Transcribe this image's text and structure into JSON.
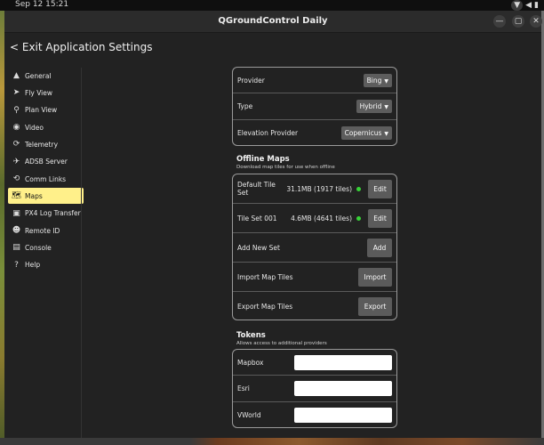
{
  "os": {
    "clock": "Sep 12  15:21",
    "tray": [
      "wifi-icon",
      "volume-icon",
      "battery-icon"
    ]
  },
  "window": {
    "title": "QGroundControl Daily",
    "controls": [
      "—",
      "▢",
      "✕"
    ]
  },
  "header": {
    "exit_label": "< Exit Application Settings"
  },
  "sidebar": {
    "items": [
      {
        "label": "General",
        "icon": "qgc-logo-icon",
        "glyph": "▲"
      },
      {
        "label": "Fly View",
        "icon": "paper-plane-icon",
        "glyph": "➤"
      },
      {
        "label": "Plan View",
        "icon": "map-pin-icon",
        "glyph": "⚲"
      },
      {
        "label": "Video",
        "icon": "camera-icon",
        "glyph": "◉"
      },
      {
        "label": "Telemetry",
        "icon": "telemetry-icon",
        "glyph": "⟳"
      },
      {
        "label": "ADSB Server",
        "icon": "airplane-icon",
        "glyph": "✈"
      },
      {
        "label": "Comm Links",
        "icon": "link-icon",
        "glyph": "⟲"
      },
      {
        "label": "Maps",
        "icon": "map-icon",
        "glyph": "🗺"
      },
      {
        "label": "PX4 Log Transfer",
        "icon": "log-transfer-icon",
        "glyph": "▣"
      },
      {
        "label": "Remote ID",
        "icon": "person-icon",
        "glyph": "☻"
      },
      {
        "label": "Console",
        "icon": "console-icon",
        "glyph": "▤"
      },
      {
        "label": "Help",
        "icon": "help-icon",
        "glyph": "?"
      }
    ],
    "active_index": 7
  },
  "map_settings": {
    "provider_label": "Provider",
    "provider_value": "Bing",
    "type_label": "Type",
    "type_value": "Hybrid",
    "elevation_label": "Elevation Provider",
    "elevation_value": "Copernicus"
  },
  "offline_maps": {
    "title": "Offline Maps",
    "subtitle": "Download map tiles for use when offline",
    "sets": [
      {
        "name": "Default Tile Set",
        "size": "31.1MB (1917 tiles)",
        "button": "Edit",
        "status_color": "#37d437"
      },
      {
        "name": "Tile Set 001",
        "size": "4.6MB (4641 tiles)",
        "button": "Edit",
        "status_color": "#37d437"
      }
    ],
    "add_label": "Add New Set",
    "add_button": "Add",
    "import_label": "Import Map Tiles",
    "import_button": "Import",
    "export_label": "Export Map Tiles",
    "export_button": "Export"
  },
  "tokens": {
    "title": "Tokens",
    "subtitle": "Allows access to additional providers",
    "fields": [
      {
        "label": "Mapbox",
        "value": ""
      },
      {
        "label": "Esri",
        "value": ""
      },
      {
        "label": "VWorld",
        "value": ""
      }
    ]
  },
  "colors": {
    "active_nav": "#fff08a",
    "status_ok": "#37d437",
    "panel_bg": "#222222"
  }
}
